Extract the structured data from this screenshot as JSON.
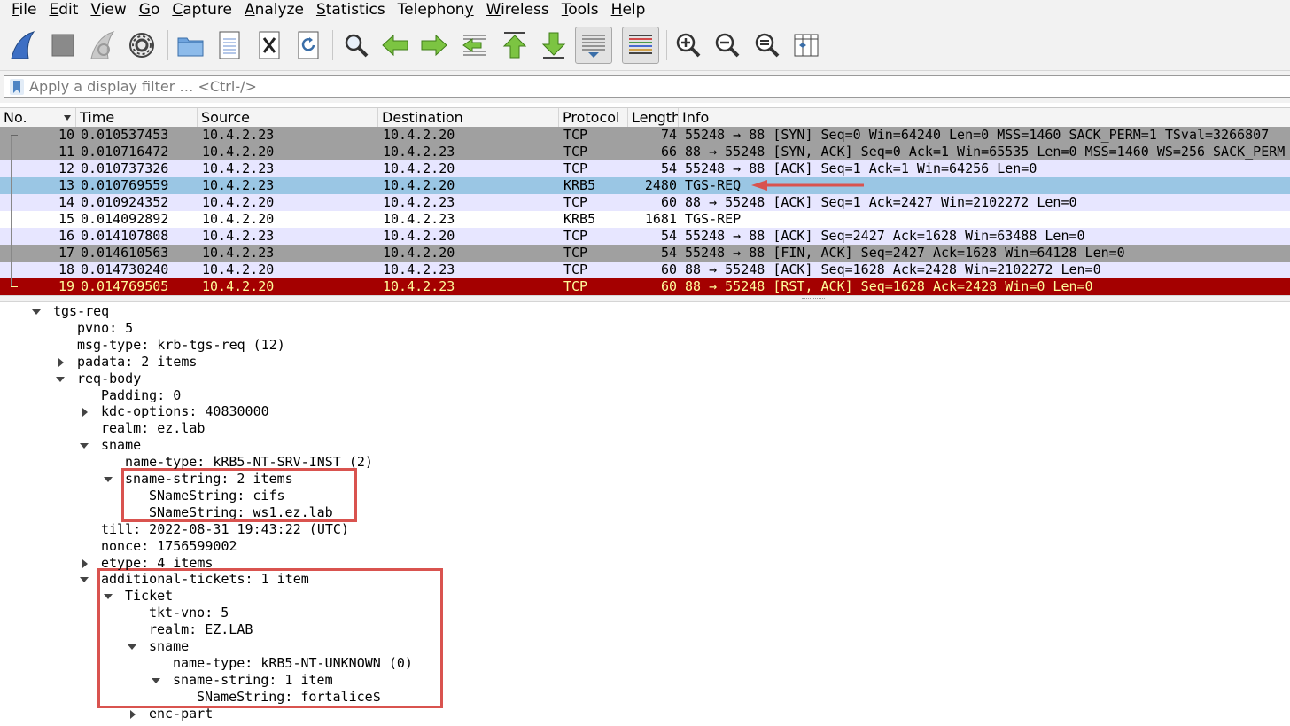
{
  "menu": [
    {
      "pre": "",
      "u": "F",
      "post": "ile"
    },
    {
      "pre": "",
      "u": "E",
      "post": "dit"
    },
    {
      "pre": "",
      "u": "V",
      "post": "iew"
    },
    {
      "pre": "",
      "u": "G",
      "post": "o"
    },
    {
      "pre": "",
      "u": "C",
      "post": "apture"
    },
    {
      "pre": "",
      "u": "A",
      "post": "nalyze"
    },
    {
      "pre": "",
      "u": "S",
      "post": "tatistics"
    },
    {
      "pre": "Telephon",
      "u": "y",
      "post": ""
    },
    {
      "pre": "",
      "u": "W",
      "post": "ireless"
    },
    {
      "pre": "",
      "u": "T",
      "post": "ools"
    },
    {
      "pre": "",
      "u": "H",
      "post": "elp"
    }
  ],
  "filter": {
    "placeholder": "Apply a display filter … <Ctrl-/>"
  },
  "columns": {
    "no": "No.",
    "time": "Time",
    "source": "Source",
    "destination": "Destination",
    "protocol": "Protocol",
    "length": "Length",
    "info": "Info"
  },
  "colors": {
    "tcp_gray": "#a0a0a0",
    "tcp_light": "#e7e6ff",
    "selected": "#9ac6e4",
    "rst_bg": "#a40000",
    "rst_fg": "#fffc9c",
    "highlight_box": "#d9534f"
  },
  "packets": [
    {
      "no": "10",
      "time": "0.010537453",
      "src": "10.4.2.23",
      "dst": "10.4.2.20",
      "proto": "TCP",
      "len": "74",
      "info": "55248 → 88 [SYN] Seq=0 Win=64240 Len=0 MSS=1460 SACK_PERM=1 TSval=3266807"
    },
    {
      "no": "11",
      "time": "0.010716472",
      "src": "10.4.2.20",
      "dst": "10.4.2.23",
      "proto": "TCP",
      "len": "66",
      "info": "88 → 55248 [SYN, ACK] Seq=0 Ack=1 Win=65535 Len=0 MSS=1460 WS=256 SACK_PERM"
    },
    {
      "no": "12",
      "time": "0.010737326",
      "src": "10.4.2.23",
      "dst": "10.4.2.20",
      "proto": "TCP",
      "len": "54",
      "info": "55248 → 88 [ACK] Seq=1 Ack=1 Win=64256 Len=0"
    },
    {
      "no": "13",
      "time": "0.010769559",
      "src": "10.4.2.23",
      "dst": "10.4.2.20",
      "proto": "KRB5",
      "len": "2480",
      "info": "TGS-REQ"
    },
    {
      "no": "14",
      "time": "0.010924352",
      "src": "10.4.2.20",
      "dst": "10.4.2.23",
      "proto": "TCP",
      "len": "60",
      "info": "88 → 55248 [ACK] Seq=1 Ack=2427 Win=2102272 Len=0"
    },
    {
      "no": "15",
      "time": "0.014092892",
      "src": "10.4.2.20",
      "dst": "10.4.2.23",
      "proto": "KRB5",
      "len": "1681",
      "info": "TGS-REP"
    },
    {
      "no": "16",
      "time": "0.014107808",
      "src": "10.4.2.23",
      "dst": "10.4.2.20",
      "proto": "TCP",
      "len": "54",
      "info": "55248 → 88 [ACK] Seq=2427 Ack=1628 Win=63488 Len=0"
    },
    {
      "no": "17",
      "time": "0.014610563",
      "src": "10.4.2.23",
      "dst": "10.4.2.20",
      "proto": "TCP",
      "len": "54",
      "info": "55248 → 88 [FIN, ACK] Seq=2427 Ack=1628 Win=64128 Len=0"
    },
    {
      "no": "18",
      "time": "0.014730240",
      "src": "10.4.2.20",
      "dst": "10.4.2.23",
      "proto": "TCP",
      "len": "60",
      "info": "88 → 55248 [ACK] Seq=1628 Ack=2428 Win=2102272 Len=0"
    },
    {
      "no": "19",
      "time": "0.014769505",
      "src": "10.4.2.20",
      "dst": "10.4.2.23",
      "proto": "TCP",
      "len": "60",
      "info": "88 → 55248 [RST, ACK] Seq=1628 Ack=2428 Win=0 Len=0"
    }
  ],
  "details": [
    {
      "text": "tgs-req",
      "depth": 0,
      "exp": "open"
    },
    {
      "text": "pvno: 5",
      "depth": 1,
      "exp": "none"
    },
    {
      "text": "msg-type: krb-tgs-req (12)",
      "depth": 1,
      "exp": "none"
    },
    {
      "text": "padata: 2 items",
      "depth": 1,
      "exp": "closed"
    },
    {
      "text": "req-body",
      "depth": 1,
      "exp": "open"
    },
    {
      "text": "Padding: 0",
      "depth": 2,
      "exp": "none"
    },
    {
      "text": "kdc-options: 40830000",
      "depth": 2,
      "exp": "closed"
    },
    {
      "text": "realm: ez.lab",
      "depth": 2,
      "exp": "none"
    },
    {
      "text": "sname",
      "depth": 2,
      "exp": "open"
    },
    {
      "text": "name-type: kRB5-NT-SRV-INST (2)",
      "depth": 3,
      "exp": "none"
    },
    {
      "text": "sname-string: 2 items",
      "depth": 3,
      "exp": "open"
    },
    {
      "text": "SNameString: cifs",
      "depth": 4,
      "exp": "none"
    },
    {
      "text": "SNameString: ws1.ez.lab",
      "depth": 4,
      "exp": "none"
    },
    {
      "text": "till: 2022-08-31 19:43:22 (UTC)",
      "depth": 2,
      "exp": "none"
    },
    {
      "text": "nonce: 1756599002",
      "depth": 2,
      "exp": "none"
    },
    {
      "text": "etype: 4 items",
      "depth": 2,
      "exp": "closed"
    },
    {
      "text": "additional-tickets: 1 item",
      "depth": 2,
      "exp": "open"
    },
    {
      "text": "Ticket",
      "depth": 3,
      "exp": "open"
    },
    {
      "text": "tkt-vno: 5",
      "depth": 4,
      "exp": "none"
    },
    {
      "text": "realm: EZ.LAB",
      "depth": 4,
      "exp": "none"
    },
    {
      "text": "sname",
      "depth": 4,
      "exp": "open"
    },
    {
      "text": "name-type: kRB5-NT-UNKNOWN (0)",
      "depth": 5,
      "exp": "none"
    },
    {
      "text": "sname-string: 1 item",
      "depth": 5,
      "exp": "open"
    },
    {
      "text": "SNameString: fortalice$",
      "depth": 6,
      "exp": "none"
    },
    {
      "text": "enc-part",
      "depth": 4,
      "exp": "closed"
    }
  ]
}
